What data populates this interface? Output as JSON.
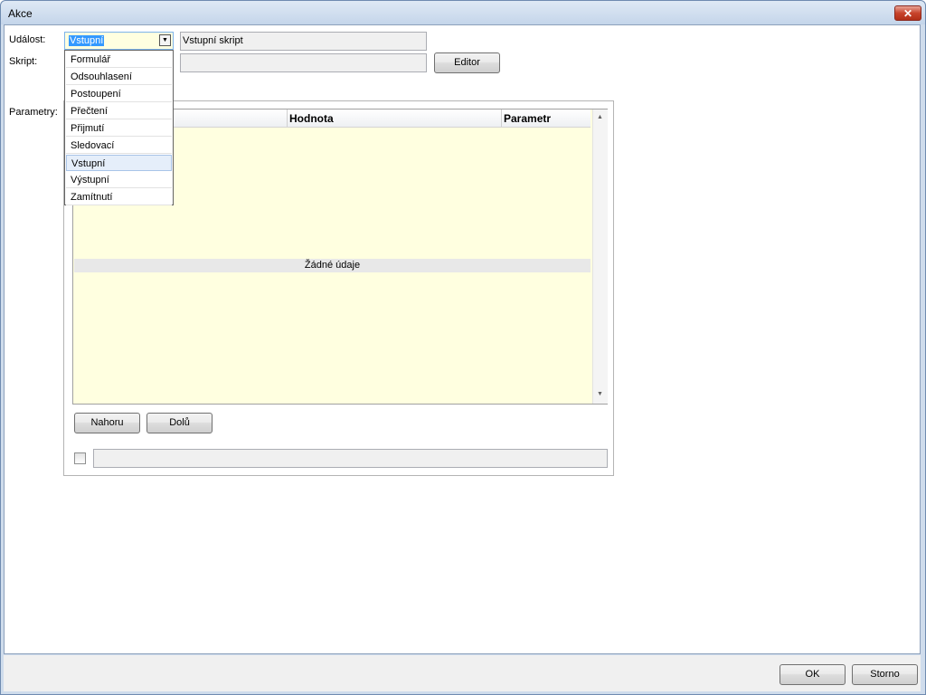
{
  "window": {
    "title": "Akce",
    "close_symbol": "✕"
  },
  "form": {
    "udalost_label": "Událost:",
    "skript_label": "Skript:",
    "parametry_label": "Parametry:",
    "event_value": "Vstupní",
    "script_name": "Vstupní skript",
    "script_value": "",
    "editor_button": "Editor"
  },
  "dropdown": {
    "items": [
      "Formulář",
      "Odsouhlasení",
      "Postoupení",
      "Přečtení",
      "Přijmutí",
      "Sledovací",
      "Vstupní",
      "Výstupní",
      "Zamítnutí"
    ],
    "selected_index": 6
  },
  "grid": {
    "columns": [
      "",
      "Hodnota",
      "Parametr"
    ],
    "empty_text": "Žádné údaje"
  },
  "buttons": {
    "up": "Nahoru",
    "down": "Dolů",
    "ok": "OK",
    "cancel": "Storno"
  },
  "bottom_field_value": "",
  "icons": {
    "dropdown_arrow": "chevron-down-icon",
    "scroll_up": "▲",
    "scroll_down": "▼"
  }
}
